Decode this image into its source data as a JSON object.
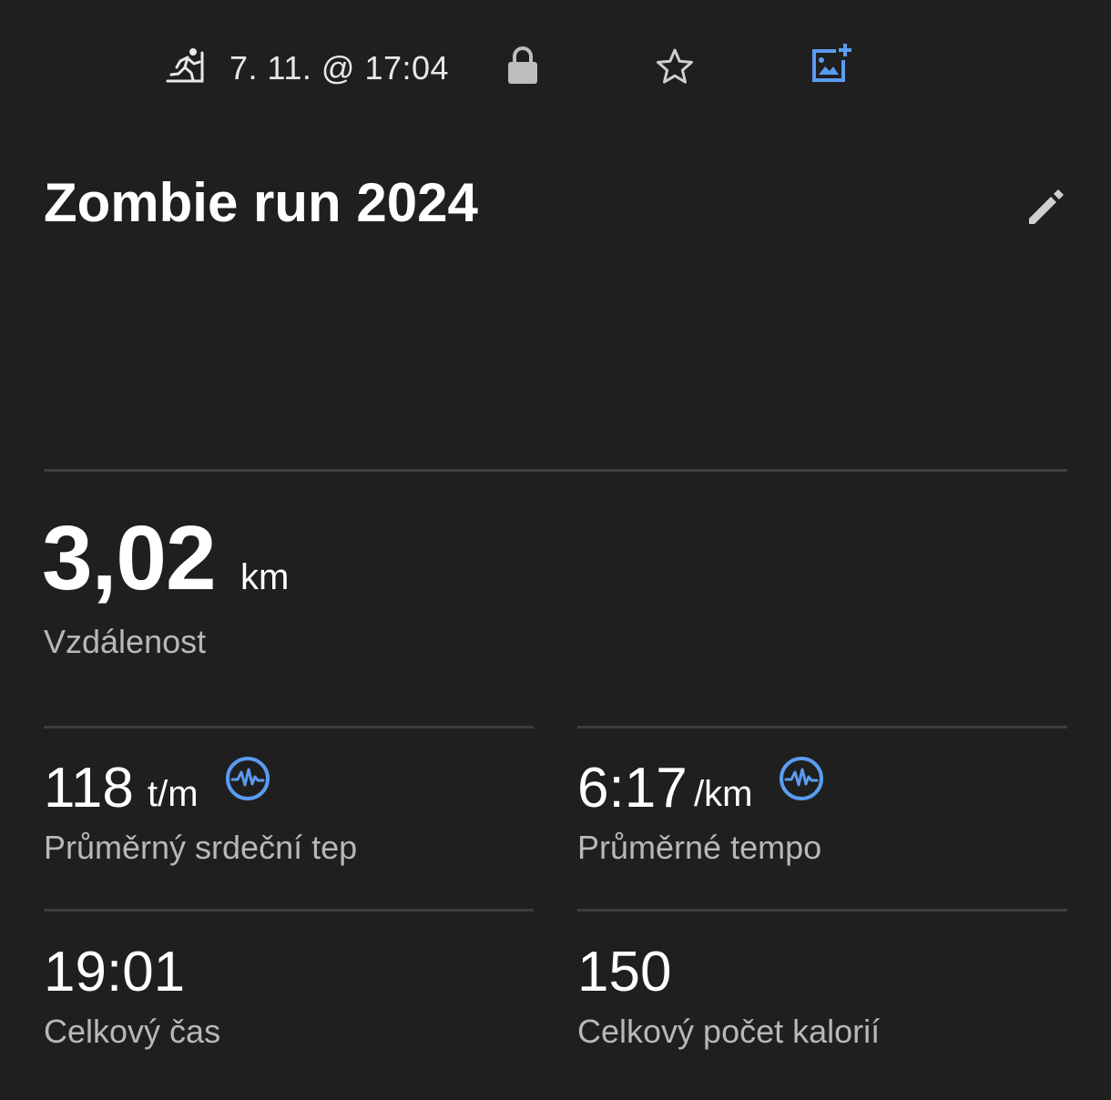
{
  "header": {
    "activity_icon": "treadmill-run-icon",
    "datetime": "7. 11. @ 17:04",
    "lock_icon": "lock-icon",
    "star_icon": "star-outline-icon",
    "add_photo_icon": "add-photo-icon"
  },
  "activity": {
    "title": "Zombie run 2024",
    "edit_icon": "pencil-icon"
  },
  "stats": {
    "distance": {
      "value": "3,02",
      "unit": "km",
      "label": "Vzdálenost"
    },
    "heart_rate": {
      "value": "118",
      "unit": "t/m",
      "label": "Průměrný srdeční tep",
      "icon": "heart-rate-chart-icon"
    },
    "pace": {
      "value": "6:17",
      "unit": "/km",
      "label": "Průměrné tempo",
      "icon": "heart-rate-chart-icon"
    },
    "total_time": {
      "value": "19:01",
      "label": "Celkový čas"
    },
    "calories": {
      "value": "150",
      "label": "Celkový počet kalorií"
    }
  },
  "colors": {
    "background": "#1f1f1f",
    "accent_blue": "#5a9cf0",
    "icon_gray": "#cfcfcf",
    "divider": "#3d3d3d",
    "label_gray": "#b8b8b8"
  }
}
